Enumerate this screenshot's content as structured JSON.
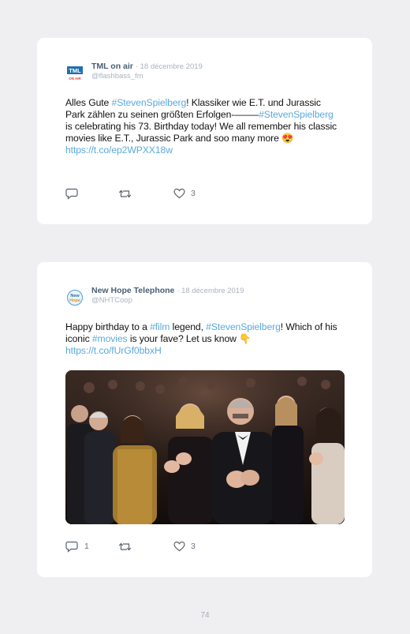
{
  "posts": [
    {
      "author": "TML on air",
      "date": "· 18 décembre 2019",
      "handle": "@flashbass_fm",
      "avatar_text": "TML",
      "avatar_subtext": "ON AIR",
      "segments": [
        {
          "t": "Alles Gute "
        },
        {
          "t": "#StevenSpielberg",
          "k": "tag"
        },
        {
          "t": "! Klassiker wie E.T. und Jurassic Park zählen zu seinen größten Erfolgen-——–"
        },
        {
          "t": "#StevenSpielberg",
          "k": "tag"
        },
        {
          "t": " is celebrating his 73. Birthday today! We all remember his classic movies like E.T., Jurassic Park and soo many more 😍 "
        },
        {
          "t": "https://t.co/ep2WPXX18w",
          "k": "link"
        }
      ],
      "reply_count": "",
      "like_count": "3"
    },
    {
      "author": "New Hope Telephone",
      "date": "· 18 décembre 2019",
      "handle": "@NHTCoop",
      "avatar_text": "New",
      "avatar_subtext": "Hope",
      "segments": [
        {
          "t": "Happy birthday to a "
        },
        {
          "t": "#film",
          "k": "tag"
        },
        {
          "t": " legend, "
        },
        {
          "t": "#StevenSpielberg",
          "k": "tag"
        },
        {
          "t": "! Which of his iconic "
        },
        {
          "t": "#movies",
          "k": "tag"
        },
        {
          "t": " is your fave? Let us know 👇 "
        },
        {
          "t": "https://t.co/fUrGf0bbxH",
          "k": "link"
        }
      ],
      "reply_count": "1",
      "like_count": "3"
    }
  ],
  "page_number": "74",
  "colors": {
    "hashtag": "#5aa9dc",
    "name": "#4a5e73",
    "meta": "#a9b3bd",
    "background": "#efeff1"
  },
  "icons": {
    "reply": "reply-icon",
    "retweet": "retweet-icon",
    "like": "heart-icon"
  }
}
